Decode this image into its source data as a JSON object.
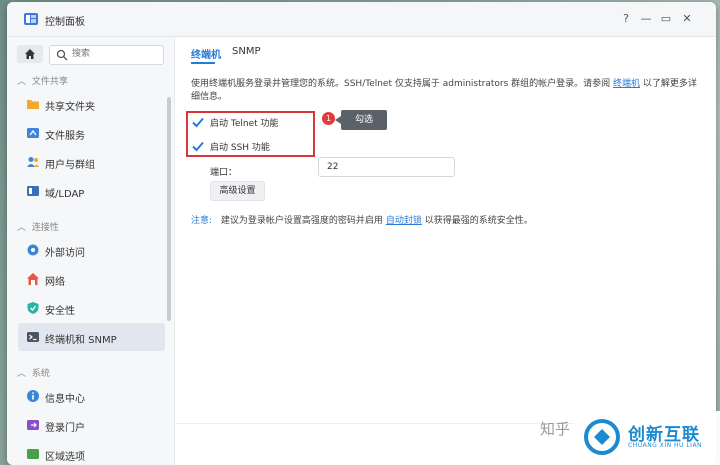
{
  "window": {
    "title": "控制面板",
    "controls": {
      "help": "?",
      "minimize": "—",
      "maximize": "▭",
      "close": "✕"
    }
  },
  "sidebar": {
    "search_placeholder": "搜索",
    "sections": [
      {
        "label": "文件共享",
        "items": [
          "共享文件夹",
          "文件服务",
          "用户与群组",
          "域/LDAP"
        ]
      },
      {
        "label": "连接性",
        "items": [
          "外部访问",
          "网络",
          "安全性",
          "终端机和 SNMP"
        ]
      },
      {
        "label": "系统",
        "items": [
          "信息中心",
          "登录门户",
          "区域选项"
        ]
      }
    ],
    "active_item": "终端机和 SNMP"
  },
  "tabs": [
    {
      "label": "终端机",
      "active": true
    },
    {
      "label": "SNMP",
      "active": false
    }
  ],
  "content": {
    "description_pre": "使用终端机服务登录并管理您的系统。SSH/Telnet 仅支持属于 administrators 群组的帐户登录。请参阅",
    "description_link": "终端机",
    "description_post": "以了解更多详细信息。",
    "telnet_label": "启动 Telnet 功能",
    "telnet_checked": true,
    "ssh_label": "启动 SSH 功能",
    "ssh_checked": true,
    "port_label": "端口：",
    "port_value": "22",
    "advanced_button": "高级设置",
    "note_label": "注意:",
    "note_pre": "建议为登录帐户设置高强度的密码并启用",
    "note_link": "自动封锁",
    "note_post": "以获得最强的系统安全性。"
  },
  "annotation": {
    "badge": "1",
    "callout": "勾选"
  },
  "watermark": {
    "text": "知乎",
    "logo_name": "创新互联",
    "logo_sub": "CHUANG XIN HU LIAN"
  },
  "colors": {
    "accent": "#2a7bd6",
    "highlight": "#d9363a",
    "active_bg": "#e2e7ef"
  }
}
